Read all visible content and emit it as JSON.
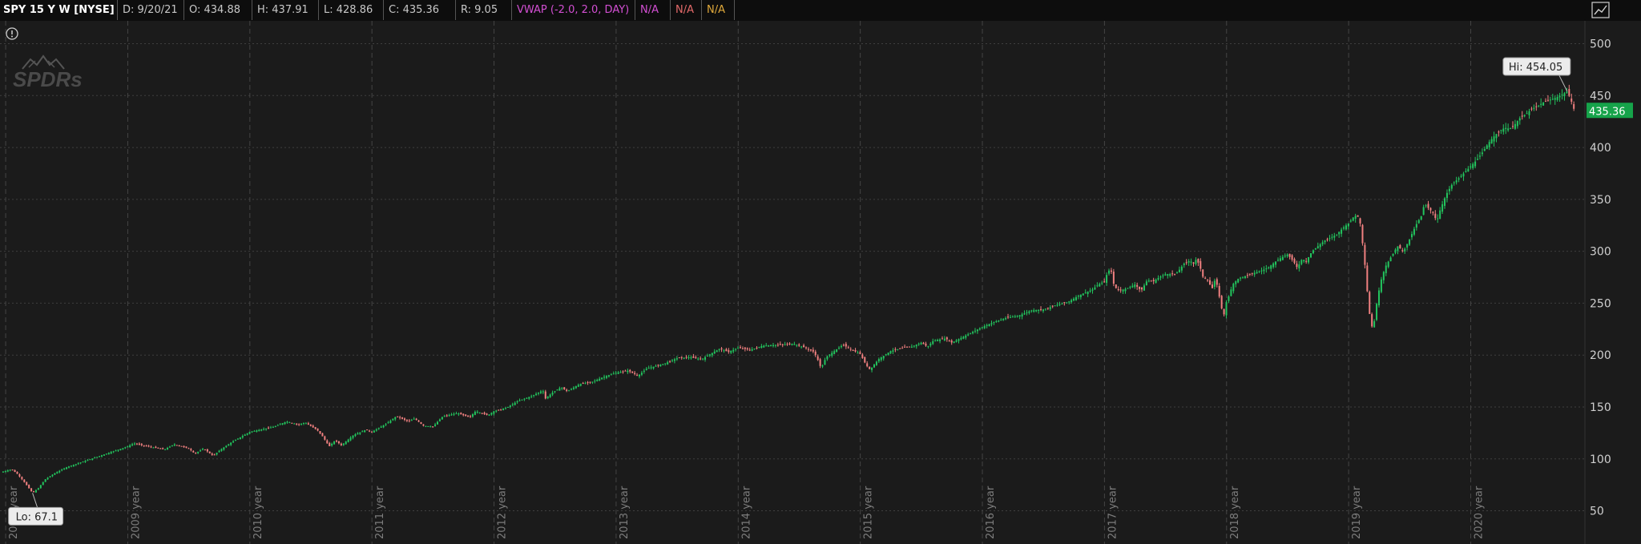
{
  "header": {
    "symbol": "SPY 15 Y W [NYSE]",
    "date": "D: 9/20/21",
    "open": "O: 434.88",
    "high": "H: 437.91",
    "low": "L: 428.86",
    "close": "C: 435.36",
    "range": "R: 9.05",
    "vwap": "VWAP (-2.0, 2.0, DAY)",
    "na1": "N/A",
    "na2": "N/A",
    "na3": "N/A"
  },
  "watermark": "SPDRs",
  "info_icon": "info-icon",
  "settings_icon": "chart-settings-icon",
  "colors": {
    "up": "#22c55e",
    "down": "#f08080",
    "background": "#1b1b1b",
    "grid": "#444444",
    "price_badge": "#16a34a"
  },
  "chart_data": {
    "type": "candlestick",
    "symbol": "SPY",
    "aggregation": "weekly",
    "x_ticks": [
      "2008 year",
      "2009 year",
      "2010 year",
      "2011 year",
      "2012 year",
      "2013 year",
      "2014 year",
      "2015 year",
      "2016 year",
      "2017 year",
      "2018 year",
      "2019 year",
      "2020 year"
    ],
    "y_ticks": [
      50,
      100,
      150,
      200,
      250,
      300,
      350,
      400,
      450,
      500
    ],
    "ylim": [
      18,
      522
    ],
    "x_range": [
      2007.96,
      2020.85
    ],
    "grid": true,
    "last_price": "435.36",
    "high_label": "Hi: 454.05",
    "low_label": "Lo: 67.1",
    "high": {
      "year": 2020.79,
      "value": 454.05
    },
    "low": {
      "year": 2008.22,
      "value": 67.1
    },
    "path": [
      [
        2007.96,
        87
      ],
      [
        2008.05,
        90
      ],
      [
        2008.1,
        85
      ],
      [
        2008.15,
        78
      ],
      [
        2008.22,
        67.1
      ],
      [
        2008.27,
        72
      ],
      [
        2008.32,
        80
      ],
      [
        2008.4,
        86
      ],
      [
        2008.5,
        92
      ],
      [
        2008.6,
        96
      ],
      [
        2008.7,
        100
      ],
      [
        2008.8,
        104
      ],
      [
        2008.9,
        108
      ],
      [
        2009.0,
        112
      ],
      [
        2009.05,
        115
      ],
      [
        2009.12,
        113
      ],
      [
        2009.3,
        109
      ],
      [
        2009.38,
        114
      ],
      [
        2009.5,
        110
      ],
      [
        2009.55,
        105
      ],
      [
        2009.62,
        110
      ],
      [
        2009.7,
        103
      ],
      [
        2009.75,
        108
      ],
      [
        2009.85,
        116
      ],
      [
        2010.0,
        126
      ],
      [
        2010.2,
        131
      ],
      [
        2010.3,
        136
      ],
      [
        2010.4,
        133
      ],
      [
        2010.45,
        135
      ],
      [
        2010.55,
        128
      ],
      [
        2010.6,
        121
      ],
      [
        2010.65,
        112
      ],
      [
        2010.7,
        118
      ],
      [
        2010.75,
        113
      ],
      [
        2010.85,
        123
      ],
      [
        2010.95,
        128
      ],
      [
        2011.0,
        126
      ],
      [
        2011.12,
        134
      ],
      [
        2011.2,
        141
      ],
      [
        2011.3,
        136
      ],
      [
        2011.35,
        139
      ],
      [
        2011.42,
        132
      ],
      [
        2011.5,
        131
      ],
      [
        2011.58,
        141
      ],
      [
        2011.7,
        144
      ],
      [
        2011.8,
        140
      ],
      [
        2011.85,
        146
      ],
      [
        2011.95,
        142
      ],
      [
        2012.0,
        146
      ],
      [
        2012.1,
        149
      ],
      [
        2012.2,
        156
      ],
      [
        2012.3,
        160
      ],
      [
        2012.4,
        166
      ],
      [
        2012.42,
        158
      ],
      [
        2012.48,
        164
      ],
      [
        2012.55,
        169
      ],
      [
        2012.6,
        165
      ],
      [
        2012.7,
        172
      ],
      [
        2012.8,
        174
      ],
      [
        2012.9,
        179
      ],
      [
        2013.0,
        183
      ],
      [
        2013.1,
        185
      ],
      [
        2013.18,
        180
      ],
      [
        2013.25,
        187
      ],
      [
        2013.4,
        192
      ],
      [
        2013.5,
        197
      ],
      [
        2013.6,
        198
      ],
      [
        2013.7,
        196
      ],
      [
        2013.8,
        203
      ],
      [
        2013.85,
        206
      ],
      [
        2013.92,
        203
      ],
      [
        2014.0,
        207
      ],
      [
        2014.1,
        205
      ],
      [
        2014.2,
        209
      ],
      [
        2014.35,
        210
      ],
      [
        2014.45,
        211
      ],
      [
        2014.55,
        207
      ],
      [
        2014.62,
        203
      ],
      [
        2014.65,
        196
      ],
      [
        2014.68,
        187
      ],
      [
        2014.72,
        198
      ],
      [
        2014.8,
        205
      ],
      [
        2014.86,
        210
      ],
      [
        2014.9,
        207
      ],
      [
        2015.0,
        201
      ],
      [
        2015.05,
        190
      ],
      [
        2015.08,
        186
      ],
      [
        2015.15,
        196
      ],
      [
        2015.25,
        204
      ],
      [
        2015.35,
        207
      ],
      [
        2015.42,
        208
      ],
      [
        2015.5,
        212
      ],
      [
        2015.55,
        208
      ],
      [
        2015.6,
        214
      ],
      [
        2015.7,
        216
      ],
      [
        2015.75,
        212
      ],
      [
        2015.85,
        218
      ],
      [
        2015.95,
        224
      ],
      [
        2016.0,
        227
      ],
      [
        2016.1,
        232
      ],
      [
        2016.2,
        236
      ],
      [
        2016.3,
        238
      ],
      [
        2016.4,
        243
      ],
      [
        2016.5,
        244
      ],
      [
        2016.6,
        248
      ],
      [
        2016.7,
        251
      ],
      [
        2016.8,
        258
      ],
      [
        2016.9,
        263
      ],
      [
        2016.95,
        268
      ],
      [
        2017.0,
        271
      ],
      [
        2017.02,
        278
      ],
      [
        2017.05,
        284
      ],
      [
        2017.08,
        266
      ],
      [
        2017.12,
        262
      ],
      [
        2017.18,
        264
      ],
      [
        2017.25,
        268
      ],
      [
        2017.3,
        262
      ],
      [
        2017.35,
        272
      ],
      [
        2017.4,
        271
      ],
      [
        2017.45,
        275
      ],
      [
        2017.5,
        278
      ],
      [
        2017.58,
        278
      ],
      [
        2017.62,
        283
      ],
      [
        2017.65,
        288
      ],
      [
        2017.7,
        291
      ],
      [
        2017.73,
        288
      ],
      [
        2017.75,
        292
      ],
      [
        2017.78,
        287
      ],
      [
        2017.8,
        276
      ],
      [
        2017.85,
        272
      ],
      [
        2017.88,
        263
      ],
      [
        2017.9,
        272
      ],
      [
        2017.93,
        266
      ],
      [
        2017.95,
        248
      ],
      [
        2017.98,
        239
      ],
      [
        2018.0,
        252
      ],
      [
        2018.02,
        257
      ],
      [
        2018.05,
        268
      ],
      [
        2018.1,
        274
      ],
      [
        2018.2,
        278
      ],
      [
        2018.3,
        282
      ],
      [
        2018.35,
        285
      ],
      [
        2018.4,
        290
      ],
      [
        2018.45,
        294
      ],
      [
        2018.5,
        297
      ],
      [
        2018.55,
        290
      ],
      [
        2018.58,
        284
      ],
      [
        2018.62,
        293
      ],
      [
        2018.65,
        290
      ],
      [
        2018.7,
        300
      ],
      [
        2018.8,
        310
      ],
      [
        2018.9,
        316
      ],
      [
        2018.95,
        322
      ],
      [
        2019.0,
        327
      ],
      [
        2019.04,
        333
      ],
      [
        2019.07,
        335
      ],
      [
        2019.1,
        325
      ],
      [
        2019.12,
        300
      ],
      [
        2019.14,
        280
      ],
      [
        2019.16,
        250
      ],
      [
        2019.18,
        232
      ],
      [
        2019.2,
        224
      ],
      [
        2019.23,
        250
      ],
      [
        2019.26,
        270
      ],
      [
        2019.3,
        285
      ],
      [
        2019.35,
        295
      ],
      [
        2019.4,
        305
      ],
      [
        2019.45,
        300
      ],
      [
        2019.5,
        312
      ],
      [
        2019.55,
        325
      ],
      [
        2019.6,
        335
      ],
      [
        2019.62,
        346
      ],
      [
        2019.65,
        342
      ],
      [
        2019.7,
        336
      ],
      [
        2019.72,
        328
      ],
      [
        2019.75,
        340
      ],
      [
        2019.8,
        355
      ],
      [
        2019.85,
        365
      ],
      [
        2019.9,
        370
      ],
      [
        2019.95,
        376
      ],
      [
        2020.0,
        382
      ],
      [
        2020.05,
        388
      ],
      [
        2020.1,
        396
      ],
      [
        2020.15,
        405
      ],
      [
        2020.2,
        412
      ],
      [
        2020.25,
        417
      ],
      [
        2020.28,
        419
      ],
      [
        2020.32,
        418
      ],
      [
        2020.36,
        422
      ],
      [
        2020.4,
        428
      ],
      [
        2020.45,
        432
      ],
      [
        2020.5,
        437
      ],
      [
        2020.55,
        440
      ],
      [
        2020.6,
        444
      ],
      [
        2020.65,
        446
      ],
      [
        2020.7,
        448
      ],
      [
        2020.75,
        451
      ],
      [
        2020.79,
        454.05
      ],
      [
        2020.82,
        446
      ],
      [
        2020.85,
        435.36
      ]
    ]
  }
}
